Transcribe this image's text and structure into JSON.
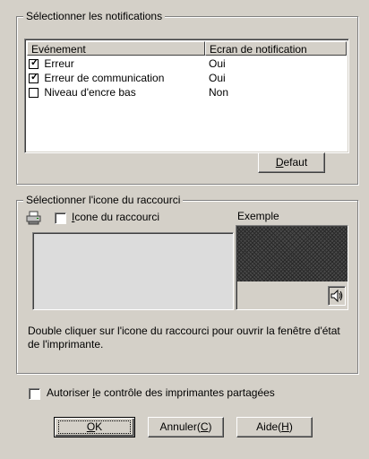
{
  "notifications": {
    "title": "Sélectionner les notifications",
    "columns": [
      "Evénement",
      "Ecran de notification"
    ],
    "rows": [
      {
        "event": "Erreur",
        "screen": "Oui",
        "checked": true
      },
      {
        "event": "Erreur de communication",
        "screen": "Oui",
        "checked": true
      },
      {
        "event": "Niveau d'encre bas",
        "screen": "Non",
        "checked": false
      }
    ],
    "default_button": {
      "mnemonic": "D",
      "rest": "efaut"
    }
  },
  "shortcut": {
    "title": "Sélectionner l'icone du raccourci",
    "checkbox": {
      "mnemonic": "I",
      "rest": "cone du raccourci",
      "checked": false
    },
    "example_label": "Exemple",
    "description": "Double cliquer sur l'icone du raccourci pour ouvrir la fenêtre d'état de l'imprimante."
  },
  "shared": {
    "label_before": "Autoriser ",
    "mnemonic": "l",
    "label_after": "e contrôle des imprimantes partagées",
    "checked": false
  },
  "buttons": {
    "ok": {
      "mnemonic": "O",
      "rest": "K"
    },
    "cancel": {
      "text": "Annuler(",
      "mnemonic": "C",
      "close": ")"
    },
    "help": {
      "text": "Aide(",
      "mnemonic": "H",
      "close": ")"
    }
  },
  "icons": {
    "printer": "printer-icon",
    "speaker": "speaker-icon"
  }
}
